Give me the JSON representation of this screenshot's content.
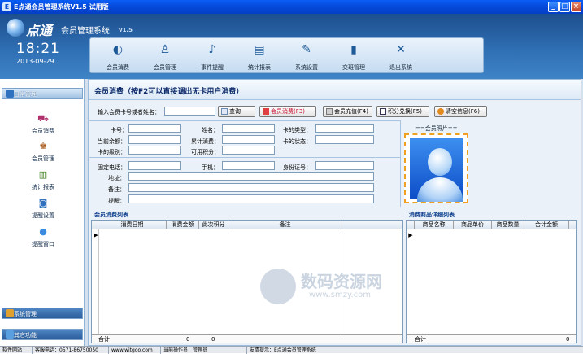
{
  "window": {
    "title": "E点通会员管理系统V1.5  试用版",
    "buttons": {
      "minimize": "_",
      "maximize": "□",
      "close": "×"
    }
  },
  "header": {
    "logo_text": "点通",
    "subtitle": "会员管理系统",
    "version": "v1.5",
    "time": "18:21",
    "date": "2013-09-29"
  },
  "toolbar": {
    "items": [
      {
        "label": "会员消费",
        "icon": "coin-icon"
      },
      {
        "label": "会员管理",
        "icon": "users-icon"
      },
      {
        "label": "事件提醒",
        "icon": "bell-icon"
      },
      {
        "label": "统计报表",
        "icon": "report-icon"
      },
      {
        "label": "系统设置",
        "icon": "wrench-icon"
      },
      {
        "label": "交班管理",
        "icon": "book-icon"
      },
      {
        "label": "退出系统",
        "icon": "close-icon"
      }
    ]
  },
  "sidebar": {
    "sections": [
      {
        "title": "日常管理"
      },
      {
        "title": "系统管理"
      },
      {
        "title": "其它功能"
      }
    ],
    "items": [
      {
        "label": "会员消费",
        "icon": "cart-icon"
      },
      {
        "label": "会员管理",
        "icon": "users-icon"
      },
      {
        "label": "统计报表",
        "icon": "chart-icon"
      },
      {
        "label": "提醒设置",
        "icon": "rss-icon"
      },
      {
        "label": "提醒窗口",
        "icon": "chat-icon"
      }
    ]
  },
  "main": {
    "title": "会员消费（按F2可以直接调出无卡用户消费）",
    "search_label": "输入会员卡号或者姓名：",
    "search_value": "",
    "buttons": {
      "query": "查询",
      "consume": "会员消费(F3)",
      "recharge": "会员充值(F4)",
      "redeem": "积分兑换(F5)",
      "clear": "清空信息(F6)"
    },
    "fields": {
      "card_no": "卡号：",
      "name": "姓名：",
      "card_type": "卡的类型：",
      "current_balance": "当前余额：",
      "total_spent": "累计消费：",
      "card_status": "卡的状态：",
      "card_level": "卡的级别：",
      "available_points": "可用积分：",
      "phone": "固定电话：",
      "mobile": "手机：",
      "id_no": "身份证号：",
      "address": "地址：",
      "note": "备注：",
      "reminder": "提醒："
    },
    "photo_label": "==会员照片=="
  },
  "consume_list": {
    "title": "会员消费列表",
    "columns": [
      "消费日期",
      "消费金额",
      "此次积分",
      "备注"
    ],
    "selector": "▶",
    "footer": {
      "label": "合计",
      "amount": "0",
      "points": "0"
    }
  },
  "detail_list": {
    "title": "消费商品详细列表",
    "columns": [
      "商品名称",
      "商品单价",
      "商品数量",
      "合计金额"
    ],
    "selector": "▶",
    "footer": {
      "label": "合计",
      "total": "0"
    }
  },
  "statusbar": {
    "cells": [
      "软件网站",
      "客服电话：0571-86750050",
      "www.witgoo.com",
      "当前操作员：管理员",
      "友情提示：E点通会员管理系统"
    ]
  },
  "watermark": {
    "title": "数码资源网",
    "url": "www.smzy.com"
  },
  "colors": {
    "header_blue": "#2f6fb3",
    "title_bar": "#0548d8",
    "consume_button_red": "#c8102e"
  }
}
